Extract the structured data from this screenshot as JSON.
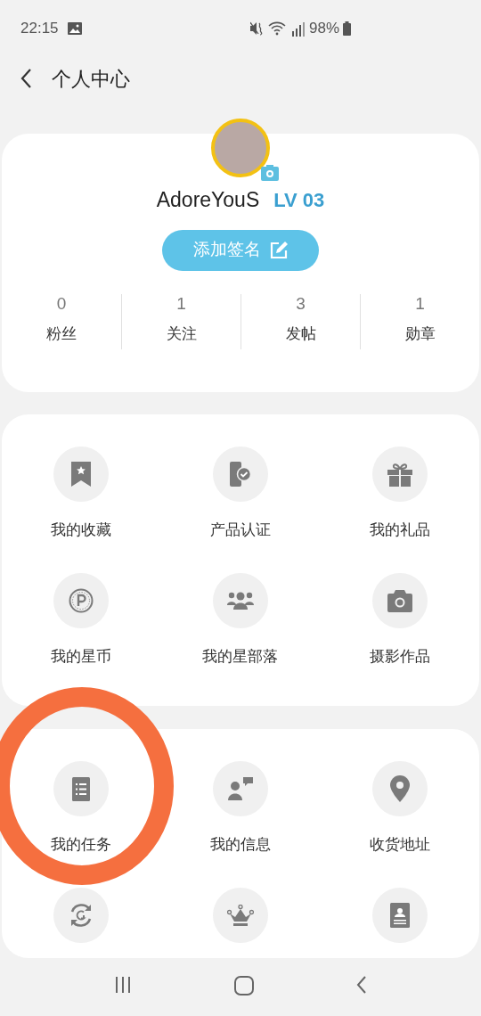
{
  "status_bar": {
    "time": "22:15",
    "battery": "98%"
  },
  "header": {
    "title": "个人中心"
  },
  "profile": {
    "name": "AdoreYouS",
    "level": "LV 03",
    "signature_button": "添加签名",
    "stats": [
      {
        "value": "0",
        "label": "粉丝"
      },
      {
        "value": "1",
        "label": "关注"
      },
      {
        "value": "3",
        "label": "发帖"
      },
      {
        "value": "1",
        "label": "勋章"
      }
    ]
  },
  "menu_sections": [
    {
      "items": [
        {
          "kind": "bookmark",
          "label": "我的收藏"
        },
        {
          "kind": "phone-check",
          "label": "产品认证"
        },
        {
          "kind": "gift",
          "label": "我的礼品"
        },
        {
          "kind": "coin",
          "label": "我的星币"
        },
        {
          "kind": "group",
          "label": "我的星部落"
        },
        {
          "kind": "camera",
          "label": "摄影作品"
        }
      ]
    },
    {
      "items": [
        {
          "kind": "list",
          "label": "我的任务"
        },
        {
          "kind": "chat-person",
          "label": "我的信息"
        },
        {
          "kind": "pin",
          "label": "收货地址"
        },
        {
          "kind": "exchange"
        },
        {
          "kind": "crown"
        },
        {
          "kind": "id-card"
        }
      ]
    }
  ],
  "annotation": {
    "color": "#f56f3f"
  }
}
